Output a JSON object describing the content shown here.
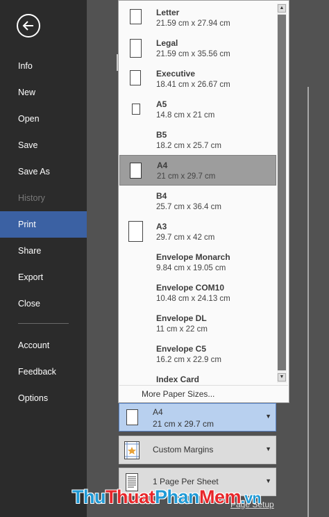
{
  "sidebar": {
    "items": [
      {
        "label": "Info",
        "state": "normal"
      },
      {
        "label": "New",
        "state": "normal"
      },
      {
        "label": "Open",
        "state": "normal"
      },
      {
        "label": "Save",
        "state": "normal"
      },
      {
        "label": "Save As",
        "state": "normal"
      },
      {
        "label": "History",
        "state": "disabled"
      },
      {
        "label": "Print",
        "state": "selected"
      },
      {
        "label": "Share",
        "state": "normal"
      },
      {
        "label": "Export",
        "state": "normal"
      },
      {
        "label": "Close",
        "state": "normal"
      }
    ],
    "bottom_items": [
      {
        "label": "Account"
      },
      {
        "label": "Feedback"
      },
      {
        "label": "Options"
      }
    ],
    "back_icon": "back-arrow-icon",
    "accent_color": "#3b61a3"
  },
  "paper_dropdown": {
    "sizes": [
      {
        "name": "Letter",
        "dims": "21.59 cm x 27.94 cm"
      },
      {
        "name": "Legal",
        "dims": "21.59 cm x 35.56 cm"
      },
      {
        "name": "Executive",
        "dims": "18.41 cm x 26.67 cm"
      },
      {
        "name": "A5",
        "dims": "14.8 cm x 21 cm"
      },
      {
        "name": "B5",
        "dims": "18.2 cm x 25.7 cm"
      },
      {
        "name": "A4",
        "dims": "21 cm x 29.7 cm"
      },
      {
        "name": "B4",
        "dims": "25.7 cm x 36.4 cm"
      },
      {
        "name": "A3",
        "dims": "29.7 cm x 42 cm"
      },
      {
        "name": "Envelope Monarch",
        "dims": "9.84 cm x 19.05 cm"
      },
      {
        "name": "Envelope COM10",
        "dims": "10.48 cm x 24.13 cm"
      },
      {
        "name": "Envelope DL",
        "dims": "11 cm x 22 cm"
      },
      {
        "name": "Envelope C5",
        "dims": "16.2 cm x 22.9 cm"
      },
      {
        "name": "Index Card",
        "dims": ""
      }
    ],
    "selected": "A4",
    "more_label": "More Paper Sizes..."
  },
  "settings": {
    "paper": {
      "name": "A4",
      "dims": "21 cm x 29.7 cm",
      "icon": "page-icon"
    },
    "margins": {
      "name": "Custom Margins",
      "icon": "custom-margins-icon"
    },
    "pages_per_sheet": {
      "name": "1 Page Per Sheet",
      "icon": "page-lines-icon"
    },
    "page_setup_link": "Page Setup"
  },
  "watermark": {
    "parts": [
      "Thu",
      "Thuat",
      "Phan",
      "Mem",
      ".vn"
    ],
    "colors": [
      "#1f9ad6",
      "#e8262a",
      "#1f9ad6",
      "#e8262a",
      "#1f9ad6"
    ]
  }
}
